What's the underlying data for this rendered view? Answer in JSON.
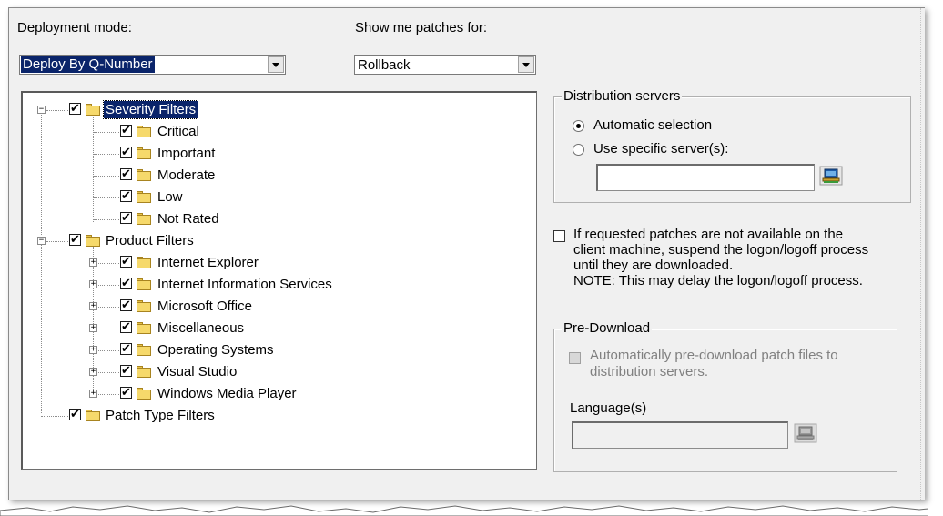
{
  "deployment": {
    "label": "Deployment mode:",
    "value": "Deploy By Q-Number"
  },
  "patches": {
    "label": "Show me patches for:",
    "value": "Rollback"
  },
  "tree": {
    "severity": {
      "label": "Severity Filters",
      "children": [
        "Critical",
        "Important",
        "Moderate",
        "Low",
        "Not Rated"
      ]
    },
    "product": {
      "label": "Product Filters",
      "children": [
        "Internet Explorer",
        "Internet Information Services",
        "Microsoft Office",
        "Miscellaneous",
        "Operating Systems",
        "Visual Studio",
        "Windows Media Player"
      ]
    },
    "patch_type": {
      "label": "Patch Type Filters"
    }
  },
  "distribution": {
    "title": "Distribution servers",
    "auto_label": "Automatic selection",
    "specific_label": "Use specific server(s):",
    "server_value": ""
  },
  "logon": {
    "line1": "If requested patches are not available on the",
    "line2": "client machine, suspend the logon/logoff process",
    "line3": "until they are downloaded.",
    "line4": "NOTE: This may delay the logon/logoff process."
  },
  "predownload": {
    "title": "Pre-Download",
    "auto_line1": "Automatically pre-download patch files to",
    "auto_line2": "distribution servers.",
    "language_label": "Language(s)",
    "language_value": ""
  },
  "icons": {
    "browse": "computer-browse-icon",
    "folder": "folder-icon",
    "checkbox": "checkbox-checked-icon"
  },
  "colors": {
    "selection": "#0a246a",
    "dialog": "#f0f0f0",
    "folder": "#f6d96b"
  }
}
